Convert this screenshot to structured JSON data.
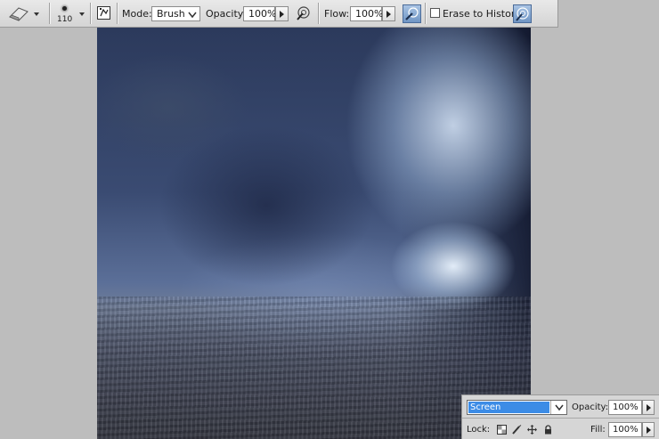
{
  "options_bar": {
    "tool_icon": "eraser-icon",
    "brush_size": "110",
    "mode_label": "Mode:",
    "mode_value": "Brush",
    "opacity_label": "Opacity:",
    "opacity_value": "100%",
    "flow_label": "Flow:",
    "flow_value": "100%",
    "erase_history_label": "Erase to History",
    "erase_history_checked": false
  },
  "layers_panel": {
    "blend_mode": "Screen",
    "opacity_label": "Opacity:",
    "opacity_value": "100%",
    "lock_label": "Lock:",
    "fill_label": "Fill:",
    "fill_value": "100%"
  },
  "colors": {
    "workspace": "#bdbdbd",
    "selection_accent": "#3c8ce6",
    "active_toggle": "#6f95c4"
  }
}
